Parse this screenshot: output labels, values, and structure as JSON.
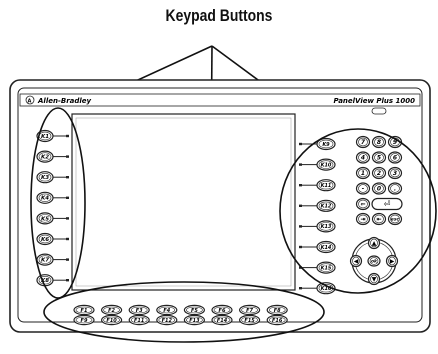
{
  "callout": {
    "label": "Keypad Buttons"
  },
  "terminal": {
    "brand": "Allen-Bradley",
    "model": "PanelView Plus 1000"
  },
  "left_keys": [
    "K1",
    "K2",
    "K3",
    "K4",
    "K5",
    "K6",
    "K7",
    "K8"
  ],
  "right_keys": [
    "K9",
    "K10",
    "K11",
    "K12",
    "K13",
    "K14",
    "K15",
    "K16"
  ],
  "function_keys": {
    "top": [
      "F1",
      "F2",
      "F3",
      "F4",
      "F5",
      "F6",
      "F7",
      "F8"
    ],
    "bottom": [
      "F9",
      "F10",
      "F11",
      "F12",
      "F13",
      "F14",
      "F15",
      "F16"
    ]
  },
  "numeric_keypad": [
    [
      "7",
      "8",
      "9"
    ],
    [
      "4",
      "5",
      "6"
    ],
    [
      "1",
      "2",
      "3"
    ],
    [
      "-",
      "0",
      "."
    ]
  ],
  "edit_keys": {
    "backspace": "⇐",
    "enter": "⏎",
    "tab": "⇥",
    "shift_tab": "⇤",
    "esc": "esc"
  },
  "nav_keys": {
    "up": "▲",
    "down": "▼",
    "left": "◀",
    "right": "▶",
    "center": "ok"
  }
}
